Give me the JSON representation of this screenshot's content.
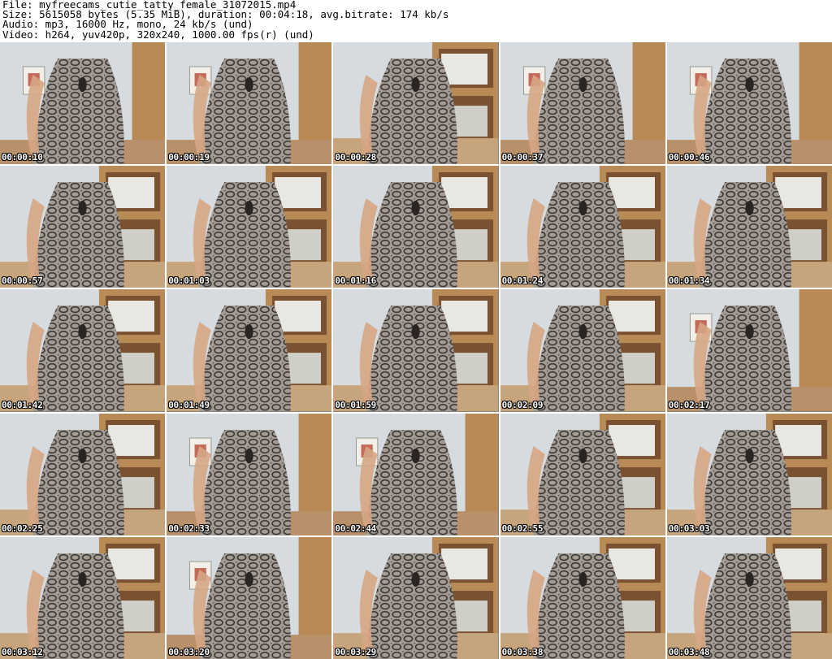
{
  "header": {
    "file_line": "File: myfreecams_cutie_tatty_female_31072015.mp4",
    "size_line": "Size: 5615058 bytes (5.35 MiB), duration: 00:04:18, avg.bitrate: 174 kb/s",
    "audio_line": "Audio: mp3, 16000 Hz, mono, 24 kb/s (und)",
    "video_line": "Video: h264, yuv420p, 320x240, 1000.00 fps(r) (und)"
  },
  "thumbnails": [
    {
      "timestamp": "00:00:10",
      "scene": "wall-left"
    },
    {
      "timestamp": "00:00:19",
      "scene": "wall-left"
    },
    {
      "timestamp": "00:00:28",
      "scene": "shelf"
    },
    {
      "timestamp": "00:00:37",
      "scene": "wall-left"
    },
    {
      "timestamp": "00:00:46",
      "scene": "wall-left"
    },
    {
      "timestamp": "00:00:57",
      "scene": "shelf"
    },
    {
      "timestamp": "00:01:03",
      "scene": "shelf"
    },
    {
      "timestamp": "00:01:16",
      "scene": "shelf"
    },
    {
      "timestamp": "00:01:24",
      "scene": "shelf"
    },
    {
      "timestamp": "00:01:34",
      "scene": "shelf"
    },
    {
      "timestamp": "00:01:42",
      "scene": "shelf"
    },
    {
      "timestamp": "00:01:49",
      "scene": "shelf"
    },
    {
      "timestamp": "00:01:59",
      "scene": "shelf"
    },
    {
      "timestamp": "00:02:09",
      "scene": "shelf"
    },
    {
      "timestamp": "00:02:17",
      "scene": "wall-left"
    },
    {
      "timestamp": "00:02:25",
      "scene": "shelf"
    },
    {
      "timestamp": "00:02:33",
      "scene": "wall-left"
    },
    {
      "timestamp": "00:02:44",
      "scene": "wall-left"
    },
    {
      "timestamp": "00:02:55",
      "scene": "shelf"
    },
    {
      "timestamp": "00:03:03",
      "scene": "shelf"
    },
    {
      "timestamp": "00:03:12",
      "scene": "shelf"
    },
    {
      "timestamp": "00:03:20",
      "scene": "wall-left"
    },
    {
      "timestamp": "00:03:29",
      "scene": "shelf"
    },
    {
      "timestamp": "00:03:38",
      "scene": "shelf"
    },
    {
      "timestamp": "00:03:48",
      "scene": "shelf"
    }
  ],
  "colors": {
    "wall": "#d6dbe0",
    "shelf_wood": "#b88a55",
    "shelf_dark": "#7a5232",
    "printer": "#e8e8e2",
    "dress_light": "#a29c94",
    "dress_dark": "#3a3532",
    "skin": "#d6a684",
    "timestamp_text": "#ffffff"
  }
}
